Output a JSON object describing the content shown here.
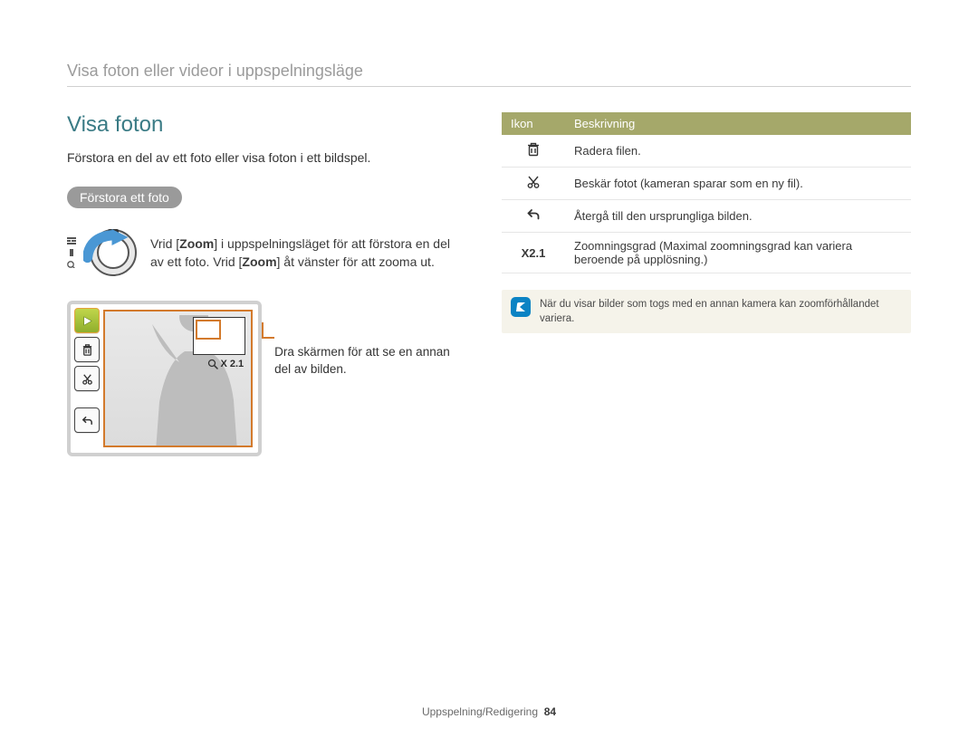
{
  "header": {
    "breadcrumb": "Visa foton eller videor i uppspelningsläge"
  },
  "main": {
    "title": "Visa foton",
    "intro": "Förstora en del av ett foto eller visa foton i ett bildspel.",
    "pill": "Förstora ett foto",
    "zoom_instruction_pre": "Vrid [",
    "zoom_word": "Zoom",
    "zoom_instruction_mid1": "] i uppspelningsläget för att förstora en del av ett foto. Vrid [",
    "zoom_instruction_mid2": "] åt vänster för att zooma ut.",
    "screen": {
      "zoom_value": "X 2.1",
      "callout": "Dra skärmen för att se en annan del av bilden."
    },
    "icons": {
      "play": "play-slideshow-icon",
      "trash": "trash-icon",
      "crop": "crop-scissors-icon",
      "back": "back-icon"
    }
  },
  "table": {
    "headers": {
      "icon": "Ikon",
      "desc": "Beskrivning"
    },
    "rows": [
      {
        "icon": "trash-icon",
        "desc": "Radera filen."
      },
      {
        "icon": "scissors-icon",
        "desc": "Beskär fotot (kameran sparar som en ny fil)."
      },
      {
        "icon": "back-icon",
        "desc": "Återgå till den ursprungliga bilden."
      },
      {
        "icon": "zoom-ratio",
        "label": "X2.1",
        "desc": "Zoomningsgrad (Maximal zoomningsgrad kan variera beroende på upplösning.)"
      }
    ]
  },
  "note": {
    "text": "När du visar bilder som togs med en annan kamera kan zoomförhållandet variera."
  },
  "footer": {
    "section": "Uppspelning/Redigering",
    "page": "84"
  }
}
